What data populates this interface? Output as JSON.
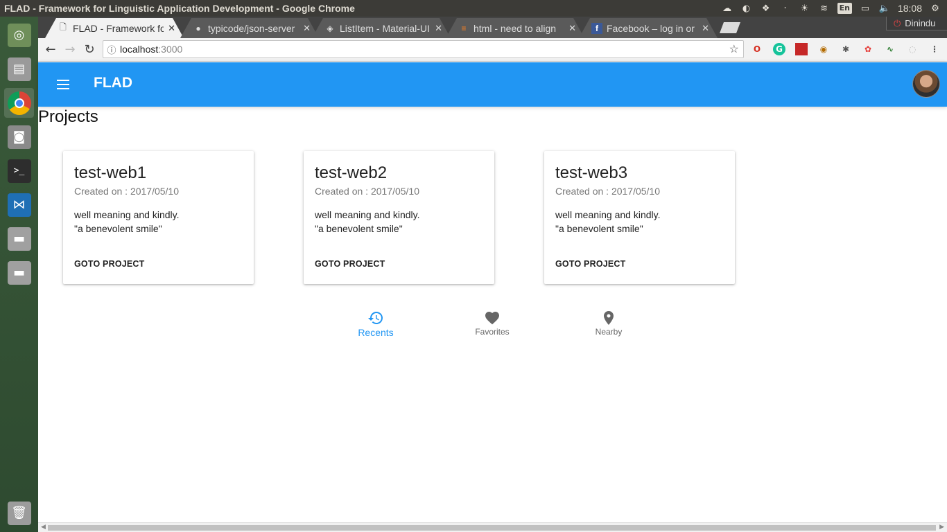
{
  "os": {
    "window_title": "FLAD - Framework for Linguistic Application Development - Google Chrome",
    "lang_indicator": "En",
    "clock": "18:08",
    "launcher_apps": [
      "ubuntu-dash",
      "files",
      "chrome",
      "screenshot",
      "terminal",
      "vscode",
      "drive-1",
      "drive-2",
      "trash"
    ]
  },
  "browser": {
    "tabs": [
      {
        "title": "FLAD - Framework for Linguistic",
        "active": true,
        "favicon": "page-icon"
      },
      {
        "title": "typicode/json-server",
        "active": false,
        "favicon": "github-icon"
      },
      {
        "title": "ListItem - Material-UI",
        "active": false,
        "favicon": "material-icon"
      },
      {
        "title": "html - need to align",
        "active": false,
        "favicon": "stackoverflow-icon"
      },
      {
        "title": "Facebook – log in or",
        "active": false,
        "favicon": "facebook-icon"
      }
    ],
    "profile_name": "Dinindu",
    "url_host": "localhost",
    "url_port": ":3000",
    "extensions": [
      "opera-icon",
      "grammarly-icon",
      "bookmark-icon",
      "owl-icon",
      "reel-icon",
      "colors-icon",
      "pulse-icon",
      "shield-icon"
    ]
  },
  "app": {
    "title": "FLAD",
    "page_title": "Projects",
    "projects": [
      {
        "name": "test-web1",
        "created": "Created on : 2017/05/10",
        "description": "well meaning and kindly.\n\"a benevolent smile\"",
        "action": "GOTO PROJECT"
      },
      {
        "name": "test-web2",
        "created": "Created on : 2017/05/10",
        "description": "well meaning and kindly.\n\"a benevolent smile\"",
        "action": "GOTO PROJECT"
      },
      {
        "name": "test-web3",
        "created": "Created on : 2017/05/10",
        "description": "well meaning and kindly.\n\"a benevolent smile\"",
        "action": "GOTO PROJECT"
      }
    ],
    "bottom_nav": [
      {
        "label": "Recents",
        "icon": "history-icon",
        "active": true
      },
      {
        "label": "Favorites",
        "icon": "heart-icon",
        "active": false
      },
      {
        "label": "Nearby",
        "icon": "location-pin-icon",
        "active": false
      }
    ]
  },
  "colors": {
    "appbar": "#2196f3",
    "active_nav": "#2196f3"
  }
}
